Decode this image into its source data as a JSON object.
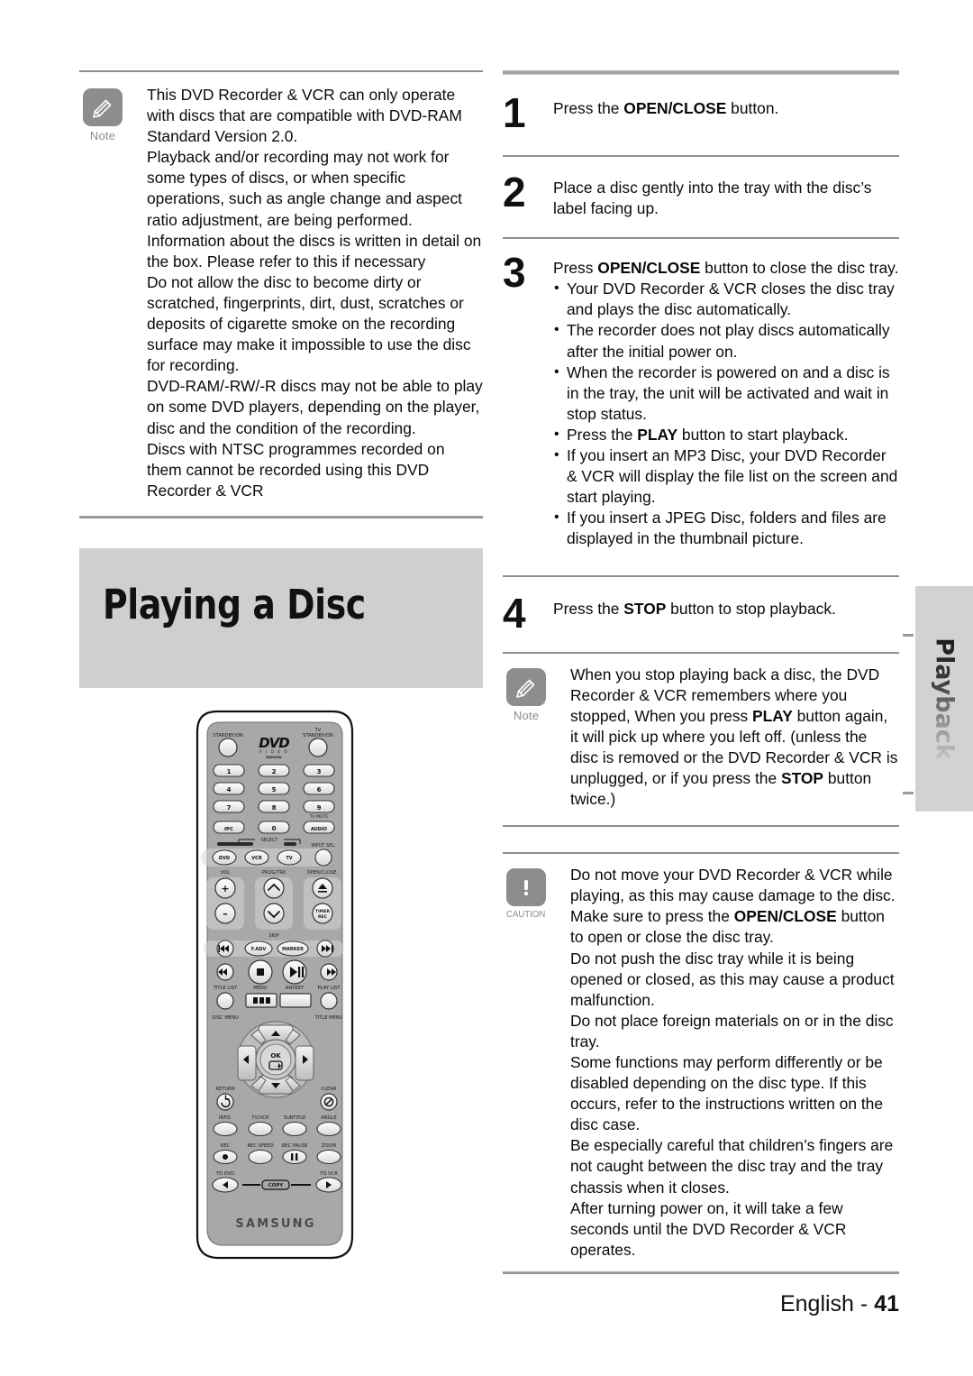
{
  "page": {
    "footer_language": "English -",
    "footer_page": "41",
    "side_tab": "Playback"
  },
  "left_column": {
    "note": {
      "badge_label": "Note",
      "icon": "pencil-icon",
      "paragraphs": [
        "This DVD Recorder & VCR can only operate with discs that are compatible with DVD-RAM Standard Version 2.0.",
        "Playback and/or recording may not work for some types of discs, or when specific operations, such as angle change and aspect ratio adjustment, are being performed. Information about the discs is written in detail on the box. Please refer to this if necessary",
        "Do not allow the disc to become dirty or scratched, fingerprints, dirt, dust, scratches or deposits of cigarette smoke on the recording surface may make it impossible to use the disc for recording.",
        "DVD-RAM/-RW/-R discs may not be able to play on some DVD players, depending on the player, disc and the condition of the recording.",
        "Discs with NTSC programmes recorded on them cannot be recorded using this DVD Recorder & VCR"
      ]
    },
    "section_title": "Playing a Disc"
  },
  "right_column": {
    "steps": [
      {
        "number": "1",
        "text_before": "Press the ",
        "bold": "OPEN/CLOSE",
        "text_after": " button."
      },
      {
        "number": "2",
        "text_before": "Place a disc gently into the tray with the disc’s label facing up.",
        "bold": "",
        "text_after": ""
      },
      {
        "number": "3",
        "text_before": "Press ",
        "bold": "OPEN/CLOSE",
        "text_after": " button to close the disc tray.",
        "bullets": [
          {
            "pre": "Your DVD Recorder & VCR closes the disc tray and plays the disc automatically.",
            "bold": "",
            "post": ""
          },
          {
            "pre": "The recorder does not play discs automatically after the initial power on.",
            "bold": "",
            "post": ""
          },
          {
            "pre": "When the recorder is powered on and a disc is in the tray, the unit will be activated and wait in stop status.",
            "bold": "",
            "post": ""
          },
          {
            "pre": "Press the ",
            "bold": "PLAY",
            "post": " button to start playback."
          },
          {
            "pre": "If you insert an MP3 Disc, your DVD Recorder & VCR will display the file list on the screen and start playing.",
            "bold": "",
            "post": ""
          },
          {
            "pre": "If you insert a JPEG Disc, folders and files are displayed in the thumbnail picture.",
            "bold": "",
            "post": ""
          }
        ]
      },
      {
        "number": "4",
        "text_before": "Press the ",
        "bold": "STOP",
        "text_after": " button to stop playback."
      }
    ],
    "note": {
      "badge_label": "Note",
      "icon": "pencil-icon",
      "segments": [
        {
          "t": "When you stop playing back a disc, the DVD Recorder & VCR remembers where you stopped, When you press ",
          "b": false
        },
        {
          "t": "PLAY",
          "b": true
        },
        {
          "t": " button again, it will pick up where you left off. (unless the disc is removed or the DVD Recorder & VCR is unplugged, or if you press the ",
          "b": false
        },
        {
          "t": "STOP",
          "b": true
        },
        {
          "t": " button twice.)",
          "b": false
        }
      ]
    },
    "caution": {
      "badge_label": "CAUTION",
      "icon": "exclamation-icon",
      "segments": [
        {
          "t": "Do not move your DVD Recorder & VCR while playing, as this may cause damage to the disc. Make sure to press the ",
          "b": false
        },
        {
          "t": "OPEN/CLOSE",
          "b": true
        },
        {
          "t": " button to open or close the disc tray.",
          "b": false
        }
      ],
      "paragraphs": [
        "Do not push the disc tray while it is being opened or closed, as this may cause a product malfunction.",
        "Do not place foreign materials on or in the disc tray.",
        "Some functions may perform differently or be disabled depending on the disc type. If this occurs, refer to the instructions written on the disc case.",
        "Be especially careful that children’s fingers are not caught between the disc tray and the tray chassis when it closes.",
        "After turning power on, it will take a few seconds until the DVD Recorder & VCR operates."
      ]
    }
  },
  "remote": {
    "brand": "SAMSUNG",
    "logo_main": "DVD",
    "logo_sub1": "V I D E O",
    "logo_sub2": "RAM/RW",
    "labels": {
      "standby_on": "STANDBY/ON",
      "tv_standby_line1": "TV",
      "tv_standby_line2": "STANDBY/ON",
      "tv_mute": "TV MUTE",
      "audio": "AUDIO",
      "ipc": "IPC",
      "select": "SELECT",
      "input_sel": "INPUT SEL.",
      "dvd": "DVD",
      "vcr": "VCR",
      "tv": "TV",
      "vol": "VOL",
      "prog_trk": "PROG/TRK",
      "open_close": "OPEN/CLOSE",
      "timer_rec_1": "TIMER",
      "timer_rec_2": "REC",
      "skip": "SKIP",
      "f_adv": "F.ADV",
      "marker": "MARKER",
      "title_list": "TITLE LIST",
      "menu": "MENU",
      "anykey": "ANYKEY",
      "play_list": "PLAY LIST",
      "disc_menu": "DISC MENU",
      "title_menu": "TITLE MENU",
      "ok": "OK",
      "return": "RETURN",
      "clear": "CLEAR",
      "info": "INFO.",
      "tv_vcr": "TV/VCR",
      "subtitle": "SUBTITLE",
      "angle": "ANGLE",
      "rec": "REC",
      "rec_speed": "REC SPEED",
      "rec_pause": "REC PAUSE",
      "zoom": "ZOOM",
      "to_dvd": "TO DVD",
      "to_vcr": "TO VCR",
      "copy": "COPY"
    },
    "numpad": [
      "1",
      "2",
      "3",
      "4",
      "5",
      "6",
      "7",
      "8",
      "9",
      "0"
    ]
  },
  "colors": {
    "banner_gray": "#cfcfcf",
    "badge_gray": "#8d8d8d",
    "rule_gray": "#9e9e9e",
    "remote_body": "#a8a8a8",
    "text_black": "#0a0a0a"
  }
}
